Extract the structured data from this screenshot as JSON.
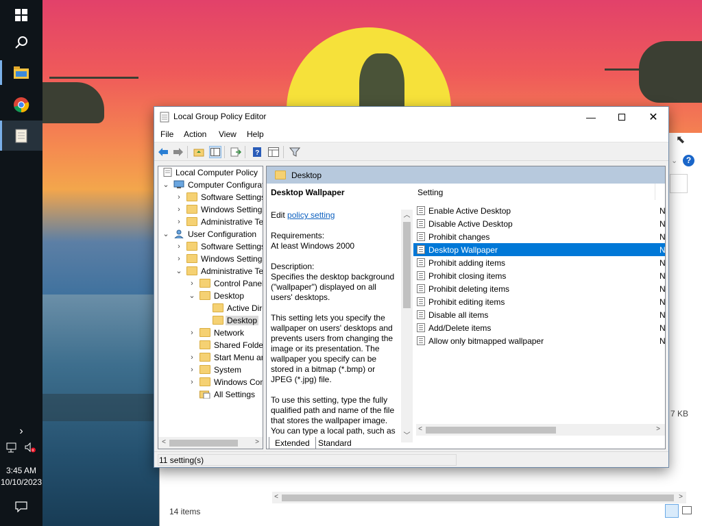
{
  "taskbar": {
    "clock_time": "3:45 AM",
    "clock_date": "10/10/2023",
    "start_icon": "windows-logo-icon",
    "search_icon": "search-icon",
    "apps": [
      "file-explorer-icon",
      "chrome-icon",
      "notepad-icon"
    ]
  },
  "background_window": {
    "status": "14 items",
    "size_fragment": "7 KB"
  },
  "window": {
    "title": "Local Group Policy Editor",
    "menu": [
      "File",
      "Action",
      "View",
      "Help"
    ],
    "tree": {
      "root": "Local Computer Policy",
      "items": [
        {
          "label": "Computer Configuration",
          "level": 1,
          "expanded": true
        },
        {
          "label": "Software Settings",
          "level": 2,
          "expanded": false
        },
        {
          "label": "Windows Settings",
          "level": 2,
          "expanded": false
        },
        {
          "label": "Administrative Templates",
          "level": 2,
          "expanded": false
        },
        {
          "label": "User Configuration",
          "level": 1,
          "expanded": true
        },
        {
          "label": "Software Settings",
          "level": 2,
          "expanded": false
        },
        {
          "label": "Windows Settings",
          "level": 2,
          "expanded": false
        },
        {
          "label": "Administrative Templates",
          "level": 2,
          "expanded": true
        },
        {
          "label": "Control Panel",
          "level": 3,
          "expanded": false
        },
        {
          "label": "Desktop",
          "level": 3,
          "expanded": true
        },
        {
          "label": "Active Directory",
          "level": 4,
          "expanded": null
        },
        {
          "label": "Desktop",
          "level": 4,
          "expanded": null,
          "selected": true
        },
        {
          "label": "Network",
          "level": 3,
          "expanded": false
        },
        {
          "label": "Shared Folders",
          "level": 3,
          "expanded": null
        },
        {
          "label": "Start Menu and Taskbar",
          "level": 3,
          "expanded": false
        },
        {
          "label": "System",
          "level": 3,
          "expanded": false
        },
        {
          "label": "Windows Components",
          "level": 3,
          "expanded": false
        },
        {
          "label": "All Settings",
          "level": 3,
          "expanded": null
        }
      ]
    },
    "right_header": "Desktop",
    "description": {
      "title": "Desktop Wallpaper",
      "edit_prefix": "Edit ",
      "edit_link": "policy setting",
      "requirements_label": "Requirements:",
      "requirements_value": "At least Windows 2000",
      "description_label": "Description:",
      "description_text": "Specifies the desktop background (\"wallpaper\") displayed on all users' desktops.",
      "para2": "This setting lets you specify the wallpaper on users' desktops and prevents users from changing the image or its presentation. The wallpaper you specify can be stored in a bitmap (*.bmp) or JPEG (*.jpg) file.",
      "para3": "To use this setting, type the fully qualified path and name of the file that stores the wallpaper image. You can type a local path, such as"
    },
    "list_header": "Setting",
    "settings": [
      {
        "name": "Enable Active Desktop",
        "state": "N"
      },
      {
        "name": "Disable Active Desktop",
        "state": "N"
      },
      {
        "name": "Prohibit changes",
        "state": "N"
      },
      {
        "name": "Desktop Wallpaper",
        "state": "N",
        "selected": true
      },
      {
        "name": "Prohibit adding items",
        "state": "N"
      },
      {
        "name": "Prohibit closing items",
        "state": "N"
      },
      {
        "name": "Prohibit deleting items",
        "state": "N"
      },
      {
        "name": "Prohibit editing items",
        "state": "N"
      },
      {
        "name": "Disable all items",
        "state": "N"
      },
      {
        "name": "Add/Delete items",
        "state": "N"
      },
      {
        "name": "Allow only bitmapped wallpaper",
        "state": "N"
      }
    ],
    "tabs": [
      "Extended",
      "Standard"
    ],
    "status": "11 setting(s)"
  },
  "colors": {
    "selection": "#0078d7",
    "header": "#b7c9dd",
    "link": "#0b5fbf"
  }
}
